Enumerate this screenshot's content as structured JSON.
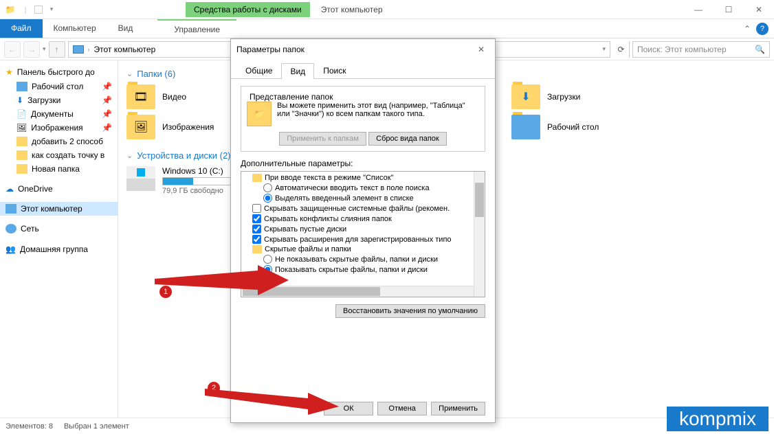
{
  "window": {
    "context_tab_group": "Средства работы с дисками",
    "title": "Этот компьютер",
    "ribbon": {
      "file": "Файл",
      "tabs": [
        "Компьютер",
        "Вид"
      ],
      "context_tab": "Управление"
    },
    "address": "Этот компьютер",
    "search_placeholder": "Поиск: Этот компьютер"
  },
  "sidebar": {
    "quick_access": "Панель быстрого до",
    "items_qa": [
      "Рабочий стол",
      "Загрузки",
      "Документы",
      "Изображения",
      "добавить 2 способ",
      "как создать точку в",
      "Новая папка"
    ],
    "onedrive": "OneDrive",
    "this_pc": "Этот компьютер",
    "network": "Сеть",
    "homegroup": "Домашняя группа"
  },
  "content": {
    "folders_header": "Папки (6)",
    "folders": [
      "Видео",
      "Загрузки",
      "Изображения",
      "Рабочий стол"
    ],
    "drives_header": "Устройства и диски (2)",
    "drive": {
      "name": "Windows 10 (C:)",
      "sub": "79,9 ГБ свободно",
      "fill_pct": 34
    }
  },
  "statusbar": {
    "elements": "Элементов: 8",
    "selected": "Выбран 1 элемент"
  },
  "dialog": {
    "title": "Параметры папок",
    "tabs": [
      "Общие",
      "Вид",
      "Поиск"
    ],
    "active_tab": 1,
    "folder_views": {
      "legend": "Представление папок",
      "text": "Вы можете применить этот вид (например, \"Таблица\" или \"Значки\") ко всем папкам такого типа.",
      "apply": "Применить к папкам",
      "reset": "Сброс вида папок"
    },
    "advanced_label": "Дополнительные параметры:",
    "tree": {
      "n0": "При вводе текста в режиме \"Список\"",
      "r0a": "Автоматически вводить текст в поле поиска",
      "r0b": "Выделять введенный элемент в списке",
      "c1": "Скрывать защищенные системные файлы (рекомен.",
      "c2": "Скрывать конфликты слияния папок",
      "c3": "Скрывать пустые диски",
      "c4": "Скрывать расширения для зарегистрированных типо",
      "n1": "Скрытые файлы и папки",
      "r1a": "Не показывать скрытые файлы, папки и диски",
      "r1b": "Показывать скрытые файлы, папки и диски"
    },
    "restore_defaults": "Восстановить значения по умолчанию",
    "buttons": {
      "ok": "ОК",
      "cancel": "Отмена",
      "apply": "Применить"
    }
  },
  "annotations": {
    "a1": "1",
    "a2": "2"
  },
  "watermark": "kompmix"
}
